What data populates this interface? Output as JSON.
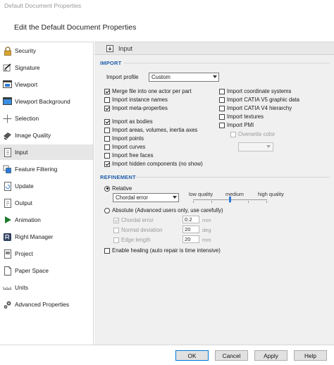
{
  "window": {
    "title": "Default Document Properties"
  },
  "heading": "Edit the Default Document Properties",
  "sidebar": {
    "items": [
      {
        "label": "Security",
        "icon": "padlock-icon"
      },
      {
        "label": "Signature",
        "icon": "signature-icon"
      },
      {
        "label": "Viewport",
        "icon": "viewport-icon"
      },
      {
        "label": "Viewport Background",
        "icon": "viewport-background-icon"
      },
      {
        "label": "Selection",
        "icon": "crosshair-icon"
      },
      {
        "label": "Image Quality",
        "icon": "image-quality-icon"
      },
      {
        "label": "Input",
        "icon": "input-icon"
      },
      {
        "label": "Feature Filtering",
        "icon": "feature-filter-icon"
      },
      {
        "label": "Update",
        "icon": "update-icon"
      },
      {
        "label": "Output",
        "icon": "output-icon"
      },
      {
        "label": "Animation",
        "icon": "play-icon"
      },
      {
        "label": "Right Manager",
        "icon": "rights-icon"
      },
      {
        "label": "Project",
        "icon": "project-icon"
      },
      {
        "label": "Paper Space",
        "icon": "paper-space-icon"
      },
      {
        "label": "Units",
        "icon": "units-ruler-icon"
      },
      {
        "label": "Advanced Properties",
        "icon": "gears-icon"
      }
    ],
    "selected": "Input"
  },
  "panel": {
    "title": "Input",
    "import_section": "IMPORT",
    "import_profile_label": "Import profile",
    "import_profile_value": "Custom",
    "left_options": [
      {
        "label": "Merge file into one actor per part",
        "checked": true
      },
      {
        "label": "Import instance names",
        "checked": false
      },
      {
        "label": "Import meta-properties",
        "checked": true
      },
      {
        "label": "Import as bodies",
        "checked": true
      },
      {
        "label": "Import areas, volumes, inertia axes",
        "checked": false
      },
      {
        "label": "Import points",
        "checked": false
      },
      {
        "label": "Import curves",
        "checked": false
      },
      {
        "label": "Import free faces",
        "checked": false
      },
      {
        "label": "Import hidden components (no show)",
        "checked": true
      }
    ],
    "right_options": [
      {
        "label": "Import coordinate systems",
        "checked": false
      },
      {
        "label": "Import CATIA V5 graphic data",
        "checked": false
      },
      {
        "label": "Import CATIA V4 hierarchy",
        "checked": false
      },
      {
        "label": "Import textures",
        "checked": false
      },
      {
        "label": "Import PMI",
        "checked": false
      }
    ],
    "overwrite_color_label": "Overwrite color",
    "overwrite_color_checked": false,
    "refinement_section": "REFINEMENT",
    "relative_label": "Relative",
    "relative_selected": true,
    "relative_mode_value": "Chordal error",
    "slider_low": "low quality",
    "slider_medium": "medium",
    "slider_high": "high quality",
    "slider_position": 0.5,
    "absolute_label": "Absolute (Advanced users only, use carefully)",
    "absolute_selected": false,
    "absolute_fields": [
      {
        "label": "Chordal error",
        "value": "0.2",
        "unit": "mm",
        "checked": true
      },
      {
        "label": "Normal deviation",
        "value": "20",
        "unit": "deg",
        "checked": false
      },
      {
        "label": "Edge length",
        "value": "20",
        "unit": "mm",
        "checked": false
      }
    ],
    "healing_label": "Enable healing (auto repair is time intensive)",
    "healing_checked": false
  },
  "buttons": {
    "ok": "OK",
    "cancel": "Cancel",
    "apply": "Apply",
    "help": "Help"
  },
  "colors": {
    "section_header": "#1e5faa",
    "slider_thumb": "#2b7ad8",
    "primary_border": "#0078d7"
  }
}
